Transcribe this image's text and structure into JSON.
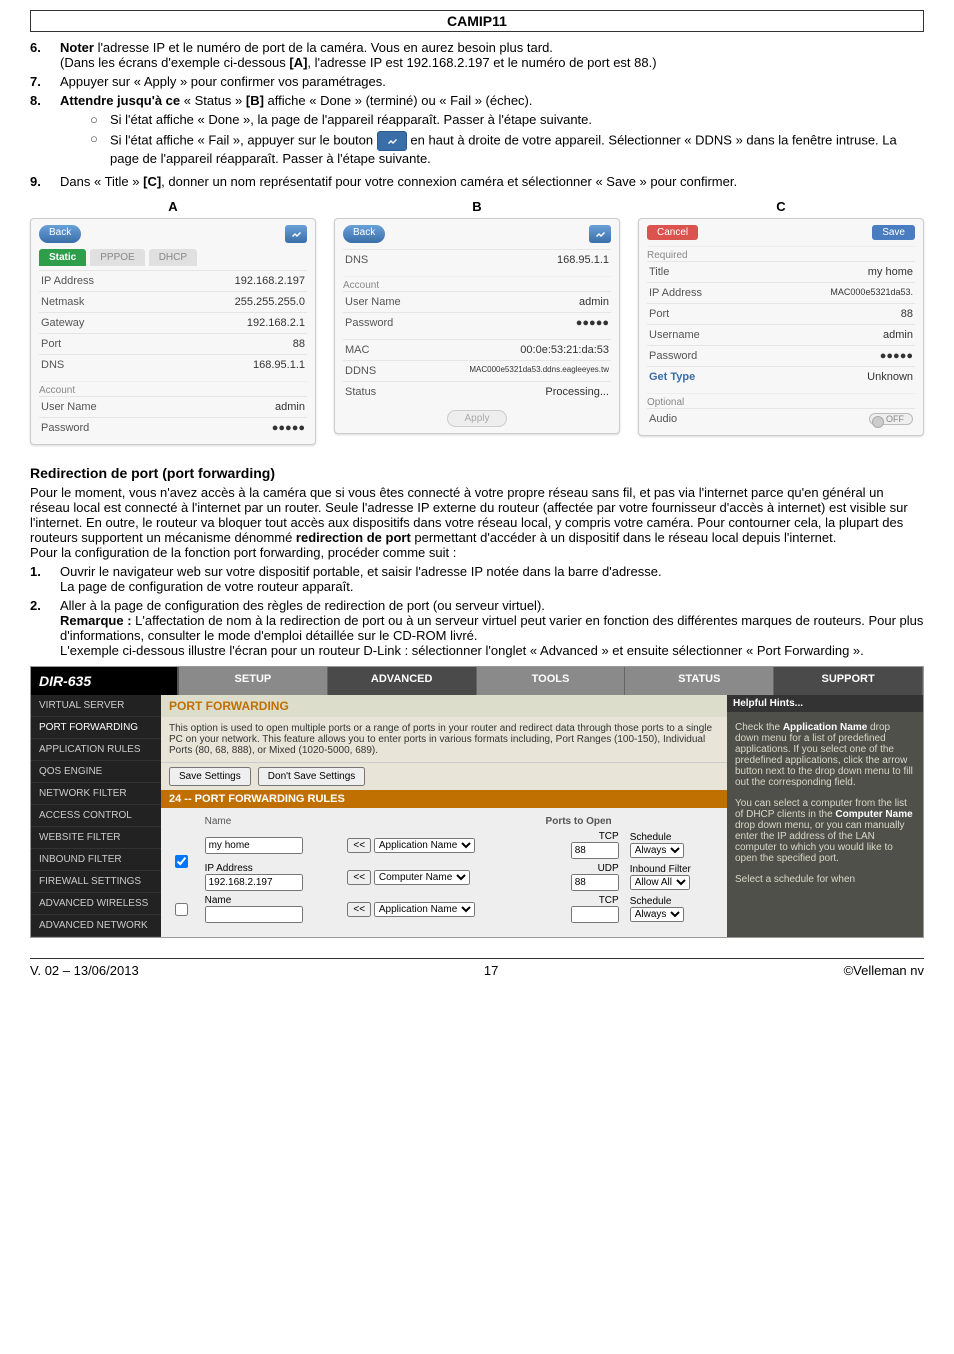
{
  "doc_title": "CAMIP11",
  "step6": {
    "num": "6.",
    "l1a": "Noter",
    "l1b": " l'adresse IP et le numéro de port de la caméra. Vous en aurez besoin plus tard.",
    "l2a": "(Dans les écrans d'exemple ci-dessous ",
    "l2b": "[A]",
    "l2c": ", l'adresse IP est 192.168.2.197 et le numéro de port est 88.)"
  },
  "step7": {
    "num": "7.",
    "text": "Appuyer sur « Apply » pour confirmer vos paramétrages."
  },
  "step8": {
    "num": "8.",
    "l1a": "Attendre jusqu'à ce",
    "l1b": " « Status » ",
    "l1c": "[B]",
    "l1d": " affiche « Done » (terminé) ou « Fail » (échec).",
    "sub1": "Si l'état affiche « Done », la page de l'appareil réapparaît. Passer à l'étape suivante.",
    "sub2a": "Si l'état affiche « Fail », appuyer sur le bouton ",
    "sub2b": " en haut à droite de votre appareil. Sélectionner « DDNS » dans la fenêtre intruse. La page de l'appareil réapparaît. Passer à l'étape suivante."
  },
  "step9": {
    "num": "9.",
    "l1a": "Dans « Title » ",
    "l1b": "[C]",
    "l1c": ", donner un nom représentatif pour votre connexion caméra et sélectionner « Save » pour confirmer."
  },
  "panelA": {
    "letter": "A",
    "back": "Back",
    "tab_static": "Static",
    "tab_pppoe": "PPPOE",
    "tab_dhcp": "DHCP",
    "ipaddr_k": "IP Address",
    "ipaddr_v": "192.168.2.197",
    "netmask_k": "Netmask",
    "netmask_v": "255.255.255.0",
    "gateway_k": "Gateway",
    "gateway_v": "192.168.2.1",
    "port_k": "Port",
    "port_v": "88",
    "dns_k": "DNS",
    "dns_v": "168.95.1.1",
    "account": "Account",
    "user_k": "User Name",
    "user_v": "admin",
    "pass_k": "Password",
    "pass_v": "●●●●●"
  },
  "panelB": {
    "letter": "B",
    "back": "Back",
    "dns_k": "DNS",
    "dns_v": "168.95.1.1",
    "account": "Account",
    "user_k": "User Name",
    "user_v": "admin",
    "pass_k": "Password",
    "pass_v": "●●●●●",
    "mac_k": "MAC",
    "mac_v": "00:0e:53:21:da:53",
    "ddns_k": "DDNS",
    "ddns_v": "MAC000e5321da53.ddns.eagleeyes.tw",
    "status_k": "Status",
    "status_v": "Processing...",
    "apply": "Apply"
  },
  "panelC": {
    "letter": "C",
    "cancel": "Cancel",
    "save": "Save",
    "required": "Required",
    "title_k": "Title",
    "title_v": "my home",
    "ipaddr_k": "IP Address",
    "ipaddr_v": "MAC000e5321da53.",
    "port_k": "Port",
    "port_v": "88",
    "user_k": "Username",
    "user_v": "admin",
    "pass_k": "Password",
    "pass_v": "●●●●●",
    "gettype_k": "Get Type",
    "gettype_v": "Unknown",
    "optional": "Optional",
    "audio_k": "Audio",
    "audio_v": "OFF"
  },
  "redirHeading": "Redirection de port (port forwarding)",
  "redirPara1": "Pour le moment, vous n'avez accès à la caméra que si vous êtes connecté à votre propre réseau sans fil, et pas via l'internet parce qu'en général un réseau local est connecté à l'internet par un router. Seule l'adresse IP externe du routeur (affectée par votre fournisseur d'accès à internet) est visible sur l'internet. En outre, le routeur va bloquer tout accès aux dispositifs dans votre réseau local, y compris votre caméra. Pour contourner cela, la plupart des routeurs supportent un mécanisme dénommé ",
  "redirBold": "redirection de port",
  "redirPara1b": " permettant d'accéder à un dispositif dans le réseau local depuis l'internet.",
  "redirPara2": "Pour la configuration de la fonction port forwarding, procéder comme suit :",
  "pf1": {
    "num": "1.",
    "l1": "Ouvrir le navigateur web sur votre dispositif portable, et saisir l'adresse IP notée dans la barre d'adresse.",
    "l2": "La page de configuration de votre routeur apparaît."
  },
  "pf2": {
    "num": "2.",
    "l1": "Aller à la page de configuration des règles de redirection de port (ou serveur virtuel).",
    "l2a": "Remarque :",
    "l2b": " L'affectation de nom à la redirection de port ou à un serveur virtuel peut varier en fonction des différentes marques de routeurs. Pour plus d'informations, consulter le mode d'emploi détaillée sur le CD-ROM livré.",
    "l3": "L'exemple ci-dessous illustre l'écran pour un routeur D-Link : sélectionner l'onglet « Advanced » et ensuite sélectionner « Port Forwarding »."
  },
  "router": {
    "logo": "DIR-635",
    "tabs": {
      "setup": "SETUP",
      "advanced": "ADVANCED",
      "tools": "TOOLS",
      "status": "STATUS",
      "support": "SUPPORT"
    },
    "side": {
      "vs": "VIRTUAL SERVER",
      "pf": "PORT FORWARDING",
      "ar": "APPLICATION RULES",
      "qos": "QOS ENGINE",
      "nf": "NETWORK FILTER",
      "ac": "ACCESS CONTROL",
      "wf": "WEBSITE FILTER",
      "if": "INBOUND FILTER",
      "fs": "FIREWALL SETTINGS",
      "aw": "ADVANCED WIRELESS",
      "an": "ADVANCED NETWORK"
    },
    "main": {
      "title": "PORT FORWARDING",
      "desc": "This option is used to open multiple ports or a range of ports in your router and redirect data through those ports to a single PC on your network. This feature allows you to enter ports in various formats including, Port Ranges (100-150), Individual Ports (80, 68, 888), or Mixed (1020-5000, 689).",
      "btn_save": "Save Settings",
      "btn_dont": "Don't Save Settings",
      "rules_h": "24 -- PORT FORWARDING RULES",
      "col_name": "Name",
      "col_ports": "Ports to Open",
      "col_tcp": "TCP",
      "col_udp": "UDP",
      "col_sched": "Schedule",
      "col_inb": "Inbound Filter",
      "col_ip": "IP Address",
      "col_comp": "Computer Name",
      "col_app": "Application Name",
      "row1_name": "my home",
      "row1_ip": "192.168.2.197",
      "row1_tcp": "88",
      "row1_udp": "88",
      "row1_sched": "Always",
      "row1_inb": "Allow All",
      "row2_sched": "Always",
      "lt": "<<"
    },
    "help": {
      "title": "Helpful Hints...",
      "p1a": "Check the ",
      "p1b": "Application Name",
      "p1c": " drop down menu for a list of predefined applications. If you select one of the predefined applications, click the arrow button next to the drop down menu to fill out the corresponding field.",
      "p2a": "You can select a computer from the list of DHCP clients in the ",
      "p2b": "Computer Name",
      "p2c": " drop down menu, or you can manually enter the IP address of the LAN computer to which you would like to open the specified port.",
      "p3": "Select a schedule for when"
    }
  },
  "footer": {
    "left": "V. 02 – 13/06/2013",
    "mid": "17",
    "right": "©Velleman nv"
  }
}
